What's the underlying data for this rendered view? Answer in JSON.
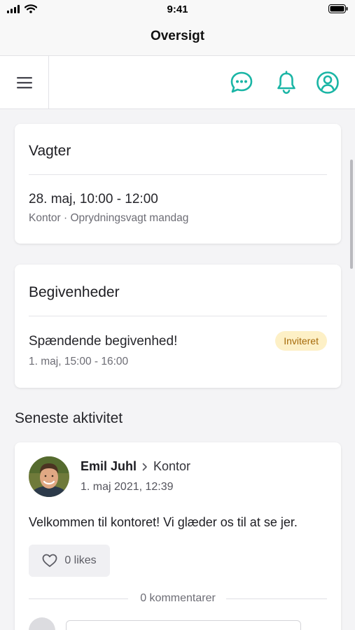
{
  "status_bar": {
    "time": "9:41"
  },
  "header": {
    "title": "Oversigt"
  },
  "toolbar": {
    "menu_icon": "hamburger-menu-icon",
    "chat_icon": "chat-bubble-icon",
    "bell_icon": "bell-icon",
    "profile_icon": "user-circle-icon",
    "accent_color": "#1ab5a5"
  },
  "shifts": {
    "title": "Vagter",
    "items": [
      {
        "time": "28. maj, 10:00 - 12:00",
        "details": "Kontor · Oprydningsvagt mandag"
      }
    ]
  },
  "events": {
    "title": "Begivenheder",
    "items": [
      {
        "name": "Spændende begivenhed!",
        "time": "1. maj, 15:00 - 16:00",
        "status": "Inviteret"
      }
    ]
  },
  "activity": {
    "heading": "Seneste aktivitet",
    "posts": [
      {
        "author": "Emil Juhl",
        "target": "Kontor",
        "date": "1. maj 2021, 12:39",
        "body": "Velkommen til kontoret! Vi glæder os til at se jer.",
        "likes": "0 likes",
        "comments": "0 kommentarer",
        "comment_placeholder": ""
      }
    ]
  }
}
